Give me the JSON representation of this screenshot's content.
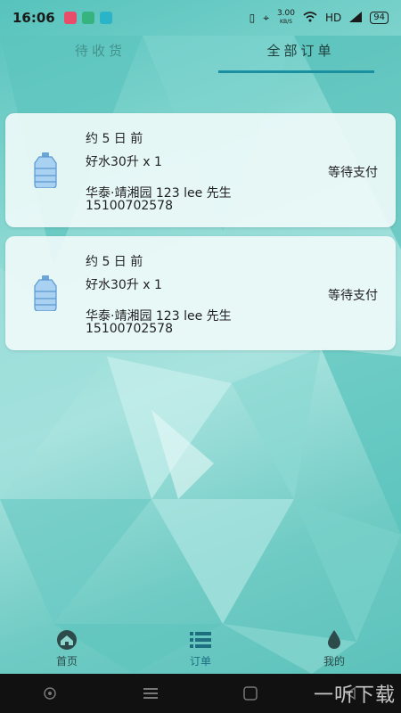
{
  "status_bar": {
    "time": "16:06",
    "network_speed": "3.00",
    "network_speed_unit": "KB/S",
    "network_type": "HD",
    "battery": "94"
  },
  "tabs": [
    {
      "label": "待收货",
      "active": false
    },
    {
      "label": "全部订单",
      "active": true
    }
  ],
  "orders": [
    {
      "time": "约 5 日 前",
      "product": "好水30升 x 1",
      "address": "华泰·靖湘园  123 lee 先生",
      "phone": "15100702578",
      "status": "等待支付",
      "icon": "water-bottle-icon"
    },
    {
      "time": "约 5 日 前",
      "product": "好水30升 x 1",
      "address": "华泰·靖湘园  123 lee 先生",
      "phone": "15100702578",
      "status": "等待支付",
      "icon": "water-bottle-icon"
    }
  ],
  "bottom_nav": {
    "home_label": "首页",
    "orders_label": "订单",
    "mine_label": "我的"
  },
  "watermark": "一听下载",
  "colors": {
    "accent": "#1a8fa0",
    "card_bg": "#eefaf9",
    "background": "#7fd0cb"
  }
}
